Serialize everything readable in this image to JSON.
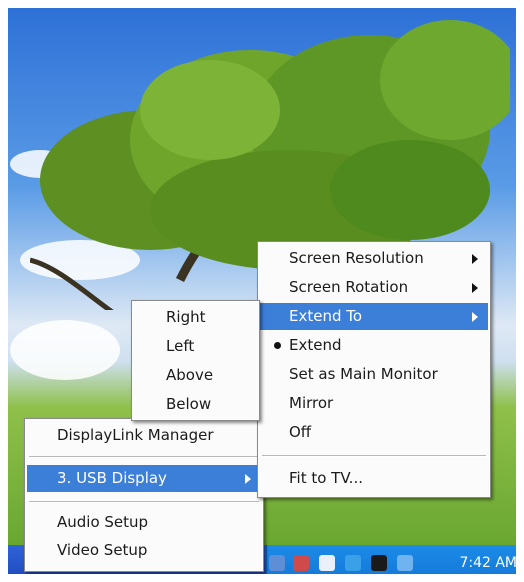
{
  "submenu_extend": {
    "items": [
      {
        "label": "Right"
      },
      {
        "label": "Left"
      },
      {
        "label": "Above"
      },
      {
        "label": "Below"
      }
    ]
  },
  "main_menu": {
    "items": [
      {
        "label": "Screen Resolution"
      },
      {
        "label": "Screen Rotation"
      },
      {
        "label": "Extend To"
      },
      {
        "label": "Extend"
      },
      {
        "label": "Set as Main Monitor"
      },
      {
        "label": "Mirror"
      },
      {
        "label": "Off"
      },
      {
        "label": "Fit to TV..."
      }
    ]
  },
  "root_menu": {
    "items": [
      {
        "label": "DisplayLink Manager"
      },
      {
        "label": "3. USB Display"
      },
      {
        "label": "Audio Setup"
      },
      {
        "label": "Video Setup"
      }
    ]
  },
  "taskbar": {
    "clock": "7:42 AM"
  },
  "icons": {
    "tray": [
      "network-icon",
      "displaylink-icon",
      "refresh-icon",
      "bluetooth-icon",
      "security-icon",
      "monitor-icon"
    ],
    "taskbar": [
      "app-icon-1",
      "app-icon-2"
    ]
  },
  "colors": {
    "highlight": "#3b7fd9",
    "taskbar": "#2f63d9",
    "tray": "#1d8be8"
  }
}
